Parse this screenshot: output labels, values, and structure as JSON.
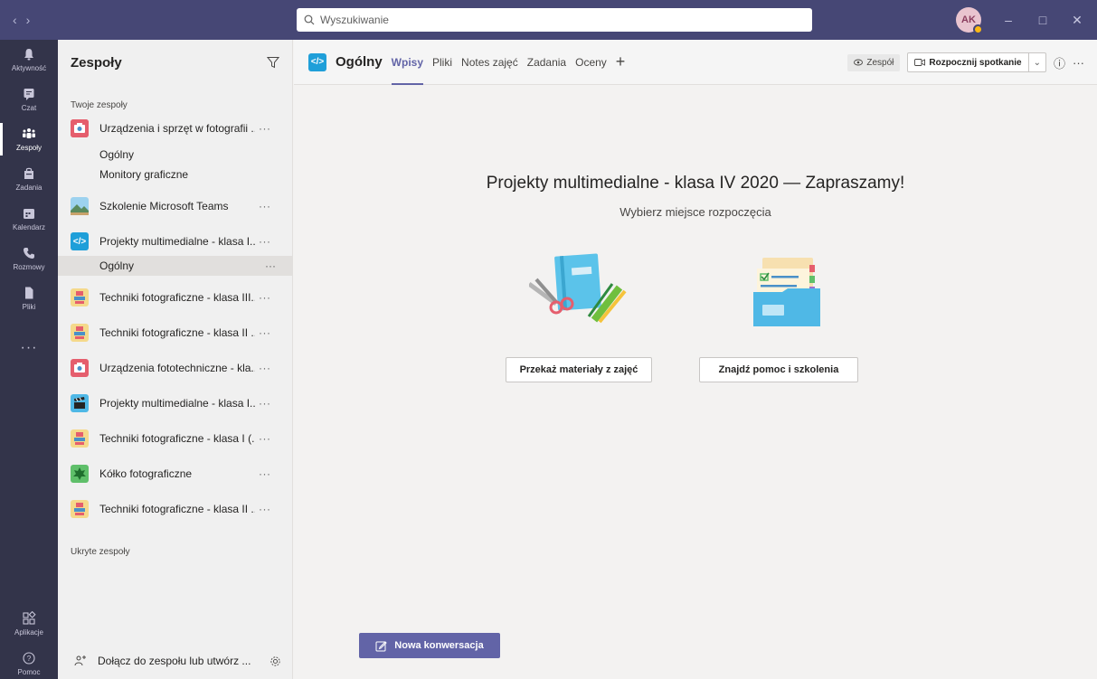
{
  "titlebar": {
    "search_placeholder": "Wyszukiwanie",
    "avatar_initials": "AK"
  },
  "appbar": {
    "items": [
      {
        "label": "Aktywność",
        "icon": "bell-icon"
      },
      {
        "label": "Czat",
        "icon": "chat-icon"
      },
      {
        "label": "Zespoły",
        "icon": "teams-icon",
        "active": true
      },
      {
        "label": "Zadania",
        "icon": "assignments-icon"
      },
      {
        "label": "Kalendarz",
        "icon": "calendar-icon"
      },
      {
        "label": "Rozmowy",
        "icon": "phone-icon"
      },
      {
        "label": "Pliki",
        "icon": "file-icon"
      }
    ],
    "more": "···",
    "bottom": [
      {
        "label": "Aplikacje",
        "icon": "apps-icon"
      },
      {
        "label": "Pomoc",
        "icon": "help-icon"
      }
    ]
  },
  "teams_panel": {
    "title": "Zespoły",
    "section_your": "Twoje zespoły",
    "section_hidden": "Ukryte zespoły",
    "teams": [
      {
        "name": "Urządzenia i sprzęt w fotografii ...",
        "tile": "camera-red"
      },
      {
        "name": "Szkolenie Microsoft Teams",
        "tile": "landscape"
      },
      {
        "name": "Projekty multimedialne - klasa I...",
        "tile": "code-blue"
      },
      {
        "name": "Techniki fotograficzne - klasa III...",
        "tile": "stamp-yellow"
      },
      {
        "name": "Techniki fotograficzne - klasa II ...",
        "tile": "stamp-yellow"
      },
      {
        "name": "Urządzenia fototechniczne - kla...",
        "tile": "camera-red"
      },
      {
        "name": "Projekty multimedialne - klasa I...",
        "tile": "clapper-blue"
      },
      {
        "name": "Techniki fotograficzne - klasa I (...",
        "tile": "stamp-yellow"
      },
      {
        "name": "Kółko fotograficzne",
        "tile": "leaf-green"
      },
      {
        "name": "Techniki fotograficzne - klasa II ...",
        "tile": "stamp-yellow"
      }
    ],
    "channels_team1": [
      "Ogólny",
      "Monitory graficzne"
    ],
    "channel_team3": "Ogólny",
    "more": "···",
    "footer": "Dołącz do zespołu lub utwórz ..."
  },
  "channel": {
    "name": "Ogólny",
    "tabs": [
      "Wpisy",
      "Pliki",
      "Notes zajęć",
      "Zadania",
      "Oceny"
    ],
    "add_tab": "+",
    "team_button": "Zespół",
    "meet_button": "Rozpocznij spotkanie",
    "info": "ⓘ",
    "more": "···"
  },
  "welcome": {
    "title": "Projekty multimedialne - klasa IV 2020 — Zapraszamy!",
    "subtitle": "Wybierz miejsce rozpoczęcia",
    "action1": "Przekaż materiały z zajęć",
    "action2": "Znajdź pomoc i szkolenia"
  },
  "new_conversation": "Nowa konwersacja",
  "colors": {
    "titlebar": "#464775",
    "appbar": "#33344a",
    "accent": "#6264a7"
  }
}
